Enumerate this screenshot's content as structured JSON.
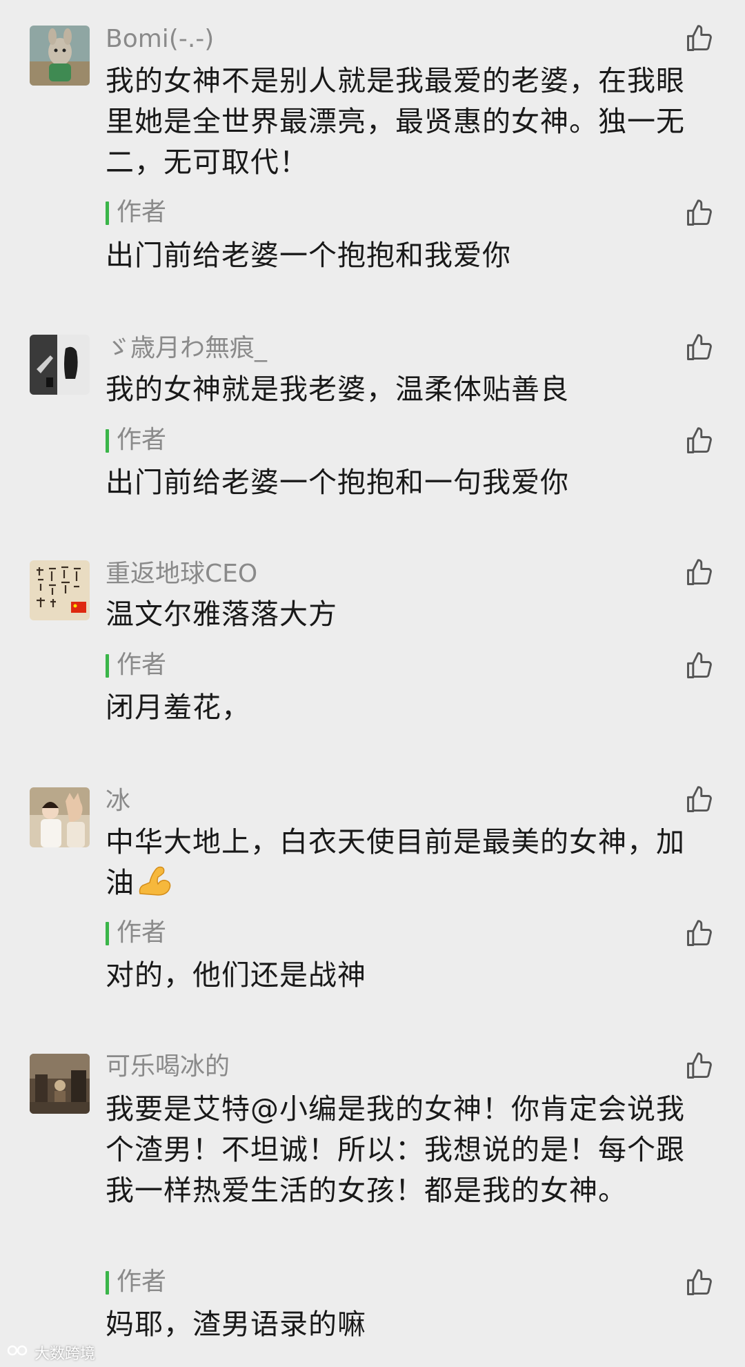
{
  "author_label": "作者",
  "comments": [
    {
      "user": "Bomi(-.-)",
      "text": "我的女神不是别人就是我最爱的老婆，在我眼里她是全世界最漂亮，最贤惠的女神。独一无二，无可取代！",
      "reply": "出门前给老婆一个抱抱和我爱你"
    },
    {
      "user": "ゞ歳月わ無痕_",
      "text": "我的女神就是我老婆，温柔体贴善良",
      "reply": "出门前给老婆一个抱抱和一句我爱你"
    },
    {
      "user": "重返地球CEO",
      "text": "温文尔雅落落大方",
      "reply": "闭月羞花，"
    },
    {
      "user": "冰",
      "text": "中华大地上，白衣天使目前是最美的女神，加油",
      "reply": "对的，他们还是战神"
    },
    {
      "user": "可乐喝冰的",
      "text": "我要是艾特@小编是我的女神！你肯定会说我个渣男！不坦诚！所以：我想说的是！每个跟我一样热爱生活的女孩！都是我的女神。",
      "reply": "妈耶，渣男语录的嘛"
    }
  ],
  "icons": {
    "like": "thumbs-up-icon",
    "emoji": "flexed-biceps-emoji"
  },
  "watermark": "大数跨境",
  "colors": {
    "background": "#ededed",
    "author_bar": "#3ab549",
    "username": "#8a8a8a",
    "text": "#191919"
  }
}
